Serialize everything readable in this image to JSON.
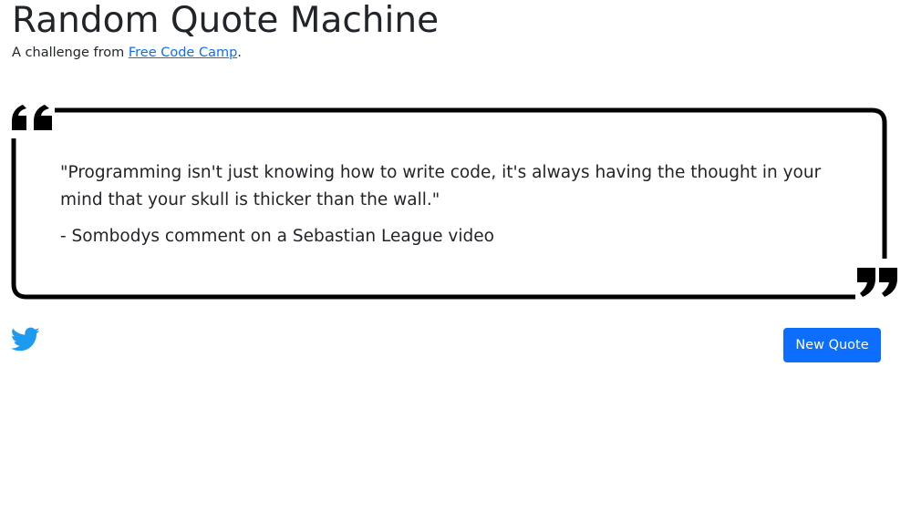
{
  "header": {
    "title": "Random Quote Machine",
    "subtitle_prefix": "A challenge from ",
    "subtitle_link": "Free Code Camp",
    "subtitle_suffix": "."
  },
  "quote": {
    "text": "\"Programming isn't just knowing how to write code, it's always having the thought in your mind that your skull is thicker than the wall.\"",
    "author": "- Sombodys comment on a Sebastian League video"
  },
  "actions": {
    "new_quote_label": "New Quote",
    "tweet_icon": "twitter-icon"
  },
  "colors": {
    "accent": "#0d6efd",
    "frame": "#000000",
    "text": "#212529"
  }
}
